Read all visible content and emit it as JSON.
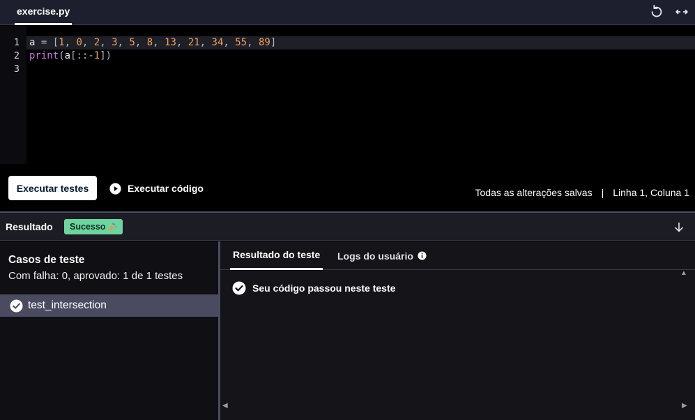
{
  "tabbar": {
    "file_name": "exercise.py",
    "reset_icon": "reset-icon",
    "expand_icon": "expand-horizontal-icon"
  },
  "editor": {
    "line_numbers": [
      "1",
      "2",
      "3"
    ],
    "lines": [
      "a = [1, 0, 2, 3, 5, 8, 13, 21, 34, 55, 89]",
      "print(a[::-1])",
      ""
    ]
  },
  "actions": {
    "run_tests_label": "Executar testes",
    "run_code_label": "Executar código",
    "play_icon": "play-circle-icon"
  },
  "status": {
    "saved": "Todas as alterações salvas",
    "separator": "|",
    "cursor": "Linha 1, Coluna 1"
  },
  "result": {
    "title": "Resultado",
    "badge": "Sucesso",
    "badge_icon": "party-popper-icon",
    "collapse_icon": "arrow-down-icon",
    "badge_color": "#6fd3a0"
  },
  "test_cases": {
    "title": "Casos de teste",
    "summary": "Com falha: 0, aprovado: 1 de 1 testes",
    "items": [
      {
        "name": "test_intersection",
        "status_icon": "check-circle-icon"
      }
    ]
  },
  "details": {
    "tabs": [
      {
        "label": "Resultado do teste",
        "active": true
      },
      {
        "label": "Logs do usuário",
        "icon": "info-icon"
      }
    ],
    "message": "Seu código passou neste teste",
    "message_icon": "check-circle-icon"
  }
}
